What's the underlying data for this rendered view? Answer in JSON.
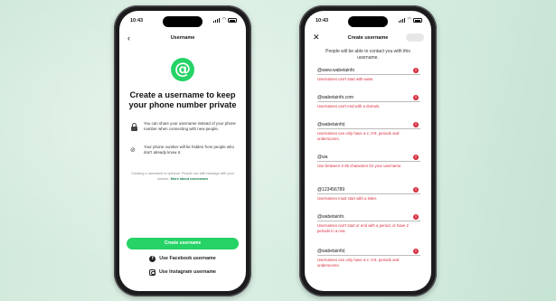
{
  "colors": {
    "accent": "#25d366",
    "error": "#d62c3c",
    "background": "#d4ece0"
  },
  "left_phone": {
    "status_time": "10:43",
    "nav": {
      "back_icon": "chevron-left-icon",
      "title": "Username"
    },
    "hero_icon": "at-sign-icon",
    "hero_symbol": "@",
    "headline": "Create a username to keep your phone number private",
    "features": [
      {
        "icon": "lock-icon",
        "text": "You can share your username instead of your phone number when connecting with new people."
      },
      {
        "icon": "eye-off-icon",
        "text": "Your phone number will be hidden from people who don't already know it."
      }
    ],
    "note_text": "Creating a username is optional. People can still message with your number.",
    "note_link": "More about usernames",
    "primary_button": "Create username",
    "facebook_button": "Use Facebook username",
    "instagram_button": "Use Instagram username"
  },
  "right_phone": {
    "status_time": "10:43",
    "nav": {
      "close_icon": "close-icon",
      "title": "Create username"
    },
    "intro": "People will be able to contact you with this username.",
    "fields": [
      {
        "value": "@www.wabetainfo",
        "error": "Usernames can't start with www."
      },
      {
        "value": "@wabetainfo.com",
        "error": "Usernames can't end with a domain."
      },
      {
        "value": "@wabetainfo|",
        "error": "Usernames can only have a-z, 0-9, periods and underscores."
      },
      {
        "value": "@wa",
        "error": "Use between 3-35 characters for your username."
      },
      {
        "value": "@123456789",
        "error": "Usernames must start with a letter."
      },
      {
        "value": "@wabetainfo.",
        "error": "Usernames can't start or end with a period, or have 2 periods in a row."
      },
      {
        "value": "@wabetainfo|",
        "error": "Usernames can only have a-z, 0-9, periods and underscores."
      }
    ]
  }
}
